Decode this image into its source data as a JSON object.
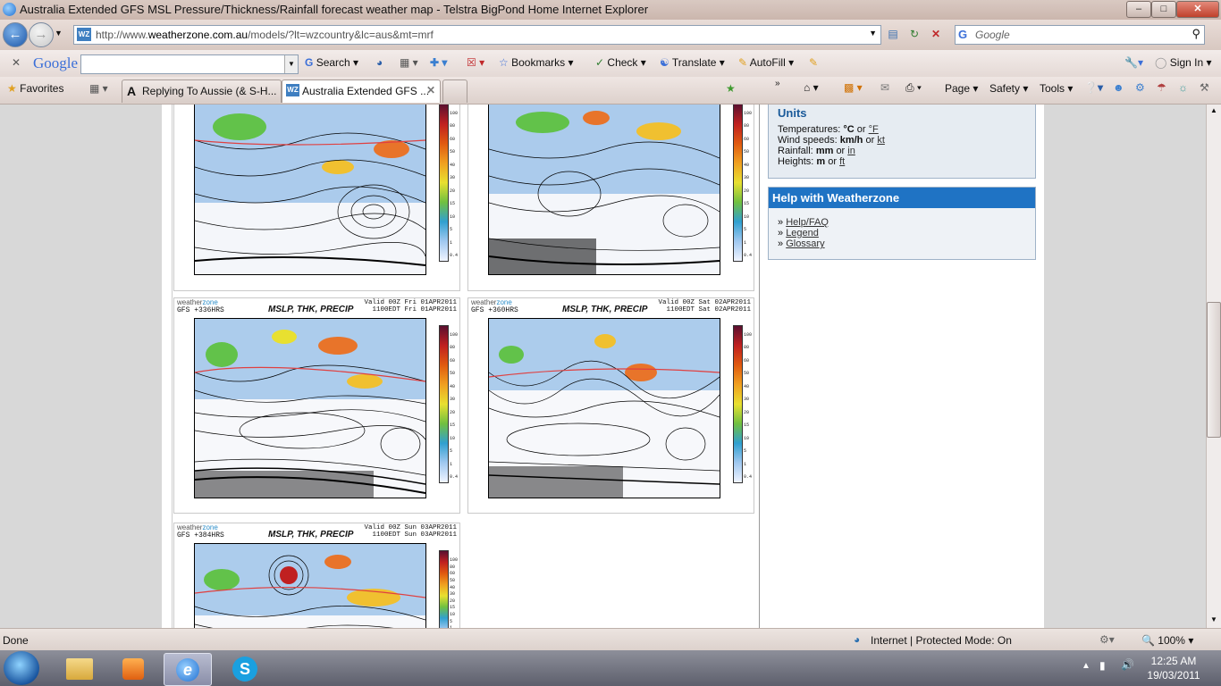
{
  "window": {
    "title": "Australia Extended GFS MSL Pressure/Thickness/Rainfall forecast weather map - Telstra BigPond Home Internet Explorer"
  },
  "address": {
    "url_prefix": "http://www.",
    "url_domain": "weatherzone.com.au",
    "url_path": "/models/?lt=wzcountry&lc=aus&mt=mrf",
    "favicon_text": "WZ",
    "search_placeholder": "Google"
  },
  "google_toolbar": {
    "logo": "Google",
    "search_label": "Search",
    "bookmarks_label": "Bookmarks",
    "check_label": "Check",
    "translate_label": "Translate",
    "autofill_label": "AutoFill",
    "signin_label": "Sign In"
  },
  "favorites_bar": {
    "favorites_label": "Favorites",
    "tabs": [
      {
        "label": "Replying To Aussie (& S-H..."
      },
      {
        "label": "Australia Extended GFS ..."
      }
    ],
    "page_label": "Page",
    "safety_label": "Safety",
    "tools_label": "Tools"
  },
  "maps": [
    {
      "brand_a": "weather",
      "brand_b": "zone",
      "gfs_line": "GFS +336HRS",
      "title": "MSLP, THK, PRECIP",
      "valid_line1": "Valid 00Z Fri 01APR2011",
      "valid_line2": "1100EDT Fri 01APR2011"
    },
    {
      "brand_a": "weather",
      "brand_b": "zone",
      "gfs_line": "GFS +360HRS",
      "title": "MSLP, THK, PRECIP",
      "valid_line1": "Valid 00Z Sat 02APR2011",
      "valid_line2": "1100EDT Sat 02APR2011"
    },
    {
      "brand_a": "weather",
      "brand_b": "zone",
      "gfs_line": "GFS +384HRS",
      "title": "MSLP, THK, PRECIP",
      "valid_line1": "Valid 00Z Sun 03APR2011",
      "valid_line2": "1100EDT Sun 03APR2011"
    }
  ],
  "colorbar_ticks": [
    "100",
    "80",
    "60",
    "50",
    "40",
    "30",
    "20",
    "15",
    "10",
    "5",
    "1",
    "0.4"
  ],
  "sidebar": {
    "units": {
      "heading": "Units",
      "rows": [
        {
          "label": "Temperatures:",
          "primary": "°C",
          "or": "or",
          "alt": "°F"
        },
        {
          "label": "Wind speeds:",
          "primary": "km/h",
          "or": "or",
          "alt": "kt"
        },
        {
          "label": "Rainfall:",
          "primary": "mm",
          "or": "or",
          "alt": "in"
        },
        {
          "label": "Heights:",
          "primary": "m",
          "or": "or",
          "alt": "ft"
        }
      ]
    },
    "help": {
      "heading": "Help with Weatherzone",
      "links": [
        "Help/FAQ",
        "Legend",
        "Glossary"
      ]
    }
  },
  "statusbar": {
    "status": "Done",
    "zone": "Internet | Protected Mode: On",
    "zoom": "100%"
  },
  "taskbar": {
    "time": "12:25 AM",
    "date": "19/03/2011"
  },
  "colors": {
    "help_header": "#1f73c4",
    "units_heading": "#1a5a9a"
  }
}
